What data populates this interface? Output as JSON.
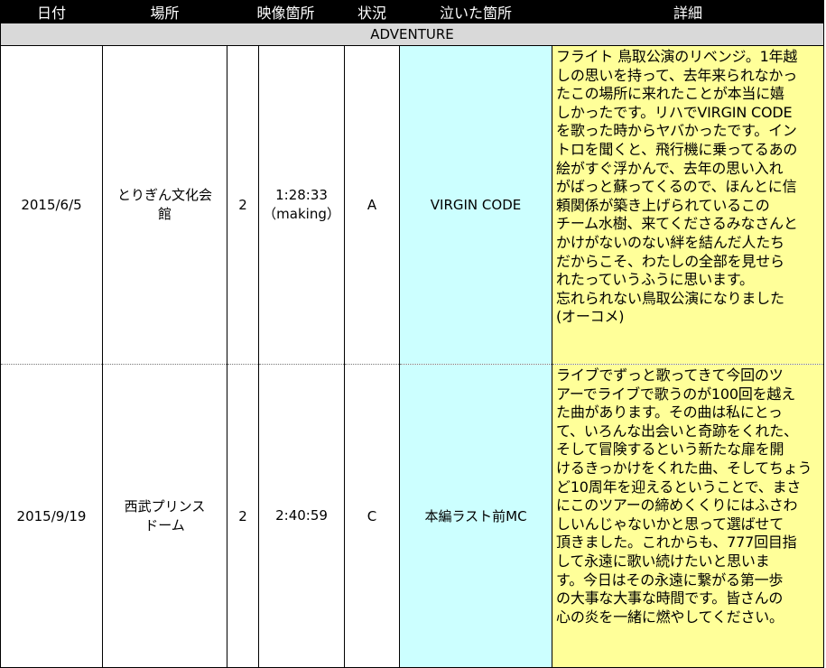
{
  "headers": [
    "日付",
    "場所",
    "映像箇所",
    "状況",
    "泣いた箇所",
    "詳細"
  ],
  "section_label": "ADVENTURE",
  "rows": [
    {
      "date": "2015/6/5",
      "venue_lines": [
        "とりぎん文化会",
        "館"
      ],
      "disc": "2",
      "time_lines": [
        "1:28:33",
        "（making）"
      ],
      "status": "A",
      "cried_at": "VIRGIN CODE",
      "detail_lines": [
        "フライト 鳥取公演のリベンジ。1年越",
        "しの思いを持って、去年来られなかっ",
        "たこの場所に来れたことが本当に嬉",
        "しかったです。リハでVIRGIN CODE",
        "を歌った時からヤバかったです。イン",
        "トロを聞くと、飛行機に乗ってるあの",
        "絵がすぐ浮かんで、去年の思い入れ",
        "がばっと蘇ってくるので、ほんとに信",
        "頼関係が築き上げられているこの",
        "チーム水樹、来てくださるみなさんと",
        "かけがないのない絆を結んだ人たち",
        "だからこそ、わたしの全部を見せら",
        "れたっていうふうに思います。",
        "忘れられない鳥取公演になりました",
        "(オーコメ)"
      ]
    },
    {
      "date": "2015/9/19",
      "venue_lines": [
        "西武プリンス",
        "ドーム"
      ],
      "disc": "2",
      "time_lines": [
        "2:40:59"
      ],
      "status": "C",
      "cried_at": "本編ラスト前MC",
      "detail_lines": [
        "ライブでずっと歌ってきて今回のツ",
        "アーでライブで歌うのが100回を越え",
        "た曲があります。その曲は私にとっ",
        "て、いろんな出会いと奇跡をくれた、",
        "そして冒険するという新たな扉を開",
        "けるきっかけをくれた曲、そしてちょう",
        "ど10周年を迎えるということで、まさ",
        "にこのツアーの締めくくりにはふさわ",
        "しいんじゃないかと思って選ばせて",
        "頂きました。これからも、777回目指",
        "して永遠に歌い続けたいと思いま",
        "す。今日はその永遠に繋がる第一歩",
        "の大事な大事な時間です。皆さんの",
        "心の炎を一緒に燃やしてください。"
      ]
    }
  ],
  "colors": {
    "header_bg": "#000000",
    "header_text": "#ffffff",
    "section_bg": "#d9d9d9",
    "cried_bg": "#ccffff",
    "detail_bg": "#ffff99"
  }
}
